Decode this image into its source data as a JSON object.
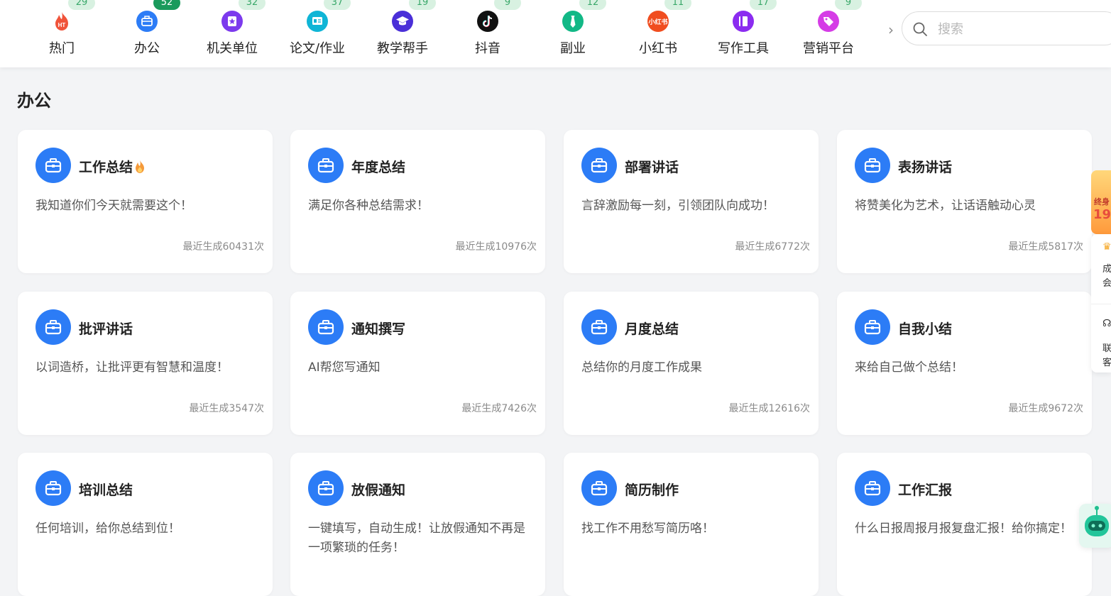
{
  "categories": [
    {
      "label": "热门",
      "count": "29",
      "icon": "hot-icon",
      "color": "#f0533a",
      "active": false
    },
    {
      "label": "办公",
      "count": "52",
      "icon": "briefcase-icon",
      "color": "#2c7cf6",
      "active": true
    },
    {
      "label": "机关单位",
      "count": "32",
      "icon": "badge-icon",
      "color": "#7c3aed",
      "active": false
    },
    {
      "label": "论文/作业",
      "count": "37",
      "icon": "paper-icon",
      "color": "#0fb5d6",
      "active": false
    },
    {
      "label": "教学帮手",
      "count": "19",
      "icon": "graduation-cap-icon",
      "color": "#4a2fd8",
      "active": false
    },
    {
      "label": "抖音",
      "count": "9",
      "icon": "tiktok-icon",
      "color": "#111111",
      "active": false
    },
    {
      "label": "副业",
      "count": "12",
      "icon": "tie-icon",
      "color": "#12b886",
      "active": false
    },
    {
      "label": "小红书",
      "count": "11",
      "icon": "xiaohongshu-icon",
      "color": "#f04d1f",
      "active": false
    },
    {
      "label": "写作工具",
      "count": "17",
      "icon": "notebook-icon",
      "color": "#8b2cf0",
      "active": false
    },
    {
      "label": "营销平台",
      "count": "9",
      "icon": "tag-icon",
      "color": "#d53ce6",
      "active": false
    }
  ],
  "search": {
    "placeholder": "搜索"
  },
  "section": {
    "title": "办公"
  },
  "cards": [
    {
      "title": "工作总结",
      "hot": true,
      "desc": "我知道你们今天就需要这个！",
      "stat": "最近生成60431次"
    },
    {
      "title": "年度总结",
      "hot": false,
      "desc": "满足你各种总结需求！",
      "stat": "最近生成10976次"
    },
    {
      "title": "部署讲话",
      "hot": false,
      "desc": "言辞激励每一刻，引领团队向成功！",
      "stat": "最近生成6772次"
    },
    {
      "title": "表扬讲话",
      "hot": false,
      "desc": "将赞美化为艺术，让话语触动心灵",
      "stat": "最近生成5817次"
    },
    {
      "title": "批评讲话",
      "hot": false,
      "desc": "以词造桥，让批评更有智慧和温度！",
      "stat": "最近生成3547次"
    },
    {
      "title": "通知撰写",
      "hot": false,
      "desc": "AI帮您写通知",
      "stat": "最近生成7426次"
    },
    {
      "title": "月度总结",
      "hot": false,
      "desc": "总结你的月度工作成果",
      "stat": "最近生成12616次"
    },
    {
      "title": "自我小结",
      "hot": false,
      "desc": "来给自己做个总结！",
      "stat": "最近生成9672次"
    },
    {
      "title": "培训总结",
      "hot": false,
      "desc": "任何培训，给你总结到位！",
      "stat": ""
    },
    {
      "title": "放假通知",
      "hot": false,
      "desc": "一键填写，自动生成！让放假通知不再是一项繁琐的任务！",
      "stat": ""
    },
    {
      "title": "简历制作",
      "hot": false,
      "desc": "找工作不用愁写简历咯！",
      "stat": ""
    },
    {
      "title": "工作汇报",
      "hot": false,
      "desc": "什么日报周报月报复盘汇报！给你搞定！",
      "stat": ""
    }
  ],
  "side": {
    "promo_line1": "终身",
    "promo_line2": "19",
    "member_label": "成会",
    "contact_label": "联客"
  },
  "colors": {
    "accent": "#2c7cf6",
    "badge_bg": "#d8f1e1",
    "badge_text": "#3aa86a",
    "badge_active": "#1a9a5c"
  }
}
